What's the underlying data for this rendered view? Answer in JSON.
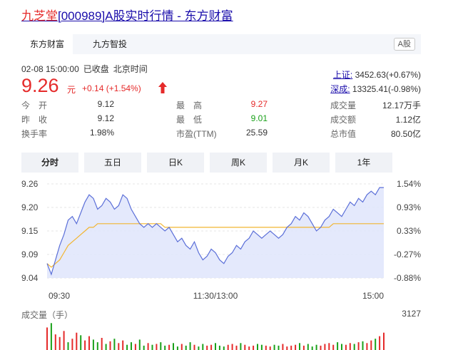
{
  "title": {
    "name": "九芝堂",
    "code": "[000989]",
    "rest": "A股实时行情 - 东方财富"
  },
  "tabs": {
    "items": [
      {
        "label": "东方财富"
      },
      {
        "label": "九方智投"
      }
    ],
    "tag": "A股"
  },
  "quote": {
    "date": "02-08 15:00:00",
    "status": "已收盘",
    "tz": "北京时间",
    "price": "9.26",
    "unit": "元",
    "change": "+0.14 (+1.54%)"
  },
  "indices": {
    "sh": {
      "label": "上证:",
      "value": "3452.63(+0.67%)"
    },
    "sz": {
      "label": "深成:",
      "value": "13325.41(-0.98%)"
    }
  },
  "stats": [
    [
      {
        "k": "今　开",
        "v": "9.12",
        "c": "#333"
      },
      {
        "k": "最　高",
        "v": "9.27",
        "c": "#e52a2a"
      },
      {
        "k": "成交量",
        "v": "12.17万手",
        "c": "#333"
      }
    ],
    [
      {
        "k": "昨　收",
        "v": "9.12",
        "c": "#333"
      },
      {
        "k": "最　低",
        "v": "9.01",
        "c": "#1aa11a"
      },
      {
        "k": "成交额",
        "v": "1.12亿",
        "c": "#333"
      }
    ],
    [
      {
        "k": "换手率",
        "v": "1.98%",
        "c": "#333"
      },
      {
        "k": "市盈(TTM)",
        "v": "25.59",
        "c": "#333"
      },
      {
        "k": "总市值",
        "v": "80.50亿",
        "c": "#333"
      }
    ]
  ],
  "ranges": [
    {
      "label": "分时"
    },
    {
      "label": "五日"
    },
    {
      "label": "日K"
    },
    {
      "label": "周K"
    },
    {
      "label": "月K"
    },
    {
      "label": "1年"
    }
  ],
  "chart_data": {
    "type": "line",
    "y_ticks": [
      "9.26",
      "9.20",
      "9.15",
      "9.09",
      "9.04"
    ],
    "pct_ticks": [
      "1.54%",
      "0.93%",
      "0.33%",
      "-0.27%",
      "-0.88%"
    ],
    "x_ticks": [
      "09:30",
      "11:30/13:00",
      "15:00"
    ],
    "ylim": [
      9.01,
      9.27
    ],
    "prev_close": 9.12,
    "colors": {
      "price": "#5b6fd8",
      "avg": "#f2b530",
      "fill": "#dfe5fb",
      "up": "#e52a2a",
      "down": "#1aa11a"
    },
    "price": [
      9.05,
      9.02,
      9.06,
      9.1,
      9.13,
      9.17,
      9.18,
      9.16,
      9.19,
      9.22,
      9.24,
      9.23,
      9.2,
      9.21,
      9.23,
      9.22,
      9.2,
      9.21,
      9.24,
      9.23,
      9.2,
      9.18,
      9.16,
      9.15,
      9.16,
      9.15,
      9.16,
      9.15,
      9.14,
      9.15,
      9.13,
      9.11,
      9.12,
      9.1,
      9.09,
      9.11,
      9.08,
      9.06,
      9.07,
      9.09,
      9.08,
      9.06,
      9.05,
      9.07,
      9.08,
      9.1,
      9.09,
      9.11,
      9.12,
      9.14,
      9.13,
      9.12,
      9.13,
      9.14,
      9.13,
      9.12,
      9.13,
      9.15,
      9.16,
      9.18,
      9.17,
      9.19,
      9.18,
      9.16,
      9.14,
      9.15,
      9.17,
      9.18,
      9.2,
      9.19,
      9.18,
      9.2,
      9.22,
      9.21,
      9.23,
      9.22,
      9.24,
      9.25,
      9.24,
      9.26,
      9.26
    ],
    "avg": [
      9.05,
      9.04,
      9.05,
      9.06,
      9.08,
      9.1,
      9.11,
      9.12,
      9.13,
      9.14,
      9.15,
      9.15,
      9.16,
      9.16,
      9.16,
      9.16,
      9.16,
      9.16,
      9.16,
      9.16,
      9.16,
      9.16,
      9.16,
      9.16,
      9.16,
      9.16,
      9.16,
      9.16,
      9.15,
      9.15,
      9.15,
      9.15,
      9.15,
      9.15,
      9.15,
      9.15,
      9.15,
      9.15,
      9.15,
      9.15,
      9.15,
      9.15,
      9.15,
      9.15,
      9.15,
      9.15,
      9.15,
      9.15,
      9.15,
      9.15,
      9.15,
      9.15,
      9.15,
      9.15,
      9.15,
      9.15,
      9.15,
      9.15,
      9.15,
      9.15,
      9.15,
      9.15,
      9.15,
      9.15,
      9.15,
      9.15,
      9.15,
      9.15,
      9.16,
      9.16,
      9.16,
      9.16,
      9.16,
      9.16,
      9.16,
      9.16,
      9.16,
      9.16,
      9.16,
      9.16,
      9.16
    ],
    "vol_label": "成交量（手）",
    "vol_max_label": "3127",
    "vol_max": 3127,
    "volume": [
      2600,
      3100,
      1800,
      1500,
      2200,
      900,
      1300,
      2000,
      1700,
      1100,
      1600,
      1200,
      900,
      1400,
      700,
      1000,
      1300,
      800,
      1100,
      600,
      900,
      700,
      1200,
      500,
      800,
      600,
      700,
      900,
      500,
      600,
      800,
      400,
      700,
      500,
      900,
      600,
      400,
      700,
      500,
      600,
      800,
      500,
      400,
      600,
      700,
      500,
      800,
      600,
      400,
      500,
      700,
      600,
      500,
      400,
      600,
      500,
      700,
      400,
      500,
      600,
      800,
      500,
      700,
      400,
      600,
      500,
      700,
      800,
      600,
      900,
      700,
      600,
      800,
      700,
      900,
      1000,
      800,
      1100,
      1300,
      1600,
      2000
    ],
    "vol_up": [
      1,
      0,
      1,
      1,
      1,
      0,
      1,
      1,
      0,
      1,
      1,
      0,
      0,
      1,
      0,
      1,
      0,
      1,
      1,
      0,
      0,
      1,
      0,
      0,
      1,
      0,
      1,
      0,
      0,
      1,
      0,
      0,
      1,
      0,
      0,
      1,
      0,
      0,
      1,
      1,
      0,
      0,
      0,
      1,
      1,
      1,
      0,
      1,
      1,
      1,
      0,
      0,
      1,
      1,
      0,
      0,
      1,
      1,
      1,
      1,
      0,
      1,
      0,
      0,
      0,
      1,
      1,
      1,
      1,
      0,
      0,
      1,
      1,
      0,
      1,
      0,
      1,
      1,
      0,
      1,
      1
    ]
  }
}
